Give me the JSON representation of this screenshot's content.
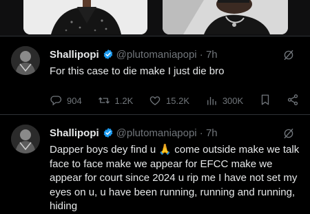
{
  "tweets": [
    {
      "name": "Shallipopi",
      "handle": "@plutomaniapopi · 7h",
      "text": "For this case to die make I just die bro",
      "stats": {
        "replies": "904",
        "reposts": "1.2K",
        "likes": "15.2K",
        "views": "300K"
      }
    },
    {
      "name": "Shallipopi",
      "handle": "@plutomaniapopi · 7h",
      "text": "Dapper boys dey find u 🙏 come outside make we talk face to face make we appear for EFCC make we appear for court since 2024 u rip me I have not set my eyes on u, u have been running, running and running, hiding"
    }
  ],
  "colors": {
    "accent": "#1d9bf0",
    "muted": "#71767b",
    "text": "#e7e9ea",
    "divider": "#2f3336"
  },
  "icons": [
    "grok-icon",
    "reply-icon",
    "repost-icon",
    "like-icon",
    "views-icon",
    "bookmark-icon",
    "share-icon",
    "verified-badge-icon"
  ]
}
